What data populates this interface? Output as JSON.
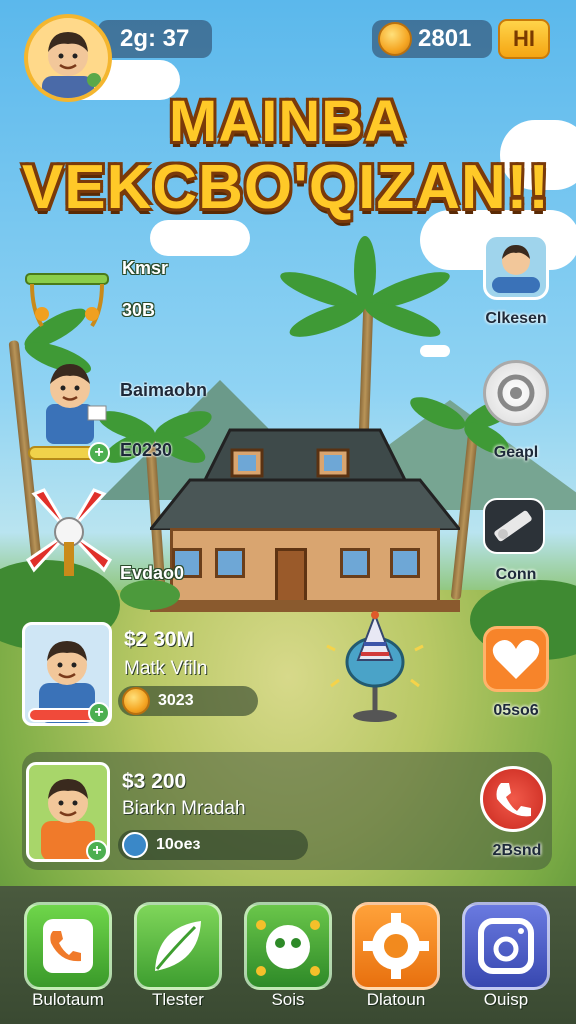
{
  "header": {
    "level_text": "2g: 37",
    "coins_text": "2801",
    "hi_label": "HI"
  },
  "title": {
    "line1": "MAINBA",
    "line2": "VEKCBO'QIZAN!!"
  },
  "left_items": [
    {
      "label": "Kmsr",
      "value": "30B"
    },
    {
      "label": "Baimaobn",
      "value": "E0230"
    },
    {
      "label": "Evdao0"
    }
  ],
  "right_buttons": [
    {
      "label": "Clkesen",
      "icon": "player-icon"
    },
    {
      "label": "Geapl",
      "icon": "settings-icon"
    },
    {
      "label": "Conn",
      "icon": "pencil-icon"
    },
    {
      "label": "05so6",
      "icon": "heart-icon",
      "color": "#f7842a"
    },
    {
      "label": "2Bsnd",
      "icon": "phone-icon",
      "color": "#e03a2e"
    }
  ],
  "cards": [
    {
      "score": "$2 30M",
      "name": "Matk Vfiln",
      "stat": "3023"
    },
    {
      "score": "$3 200",
      "name": "Biarkn Mradah",
      "stat": "10oeз"
    }
  ],
  "dock": [
    {
      "label": "Bulotaum",
      "icon": "phone-icon",
      "color": "#4cb848"
    },
    {
      "label": "Tlester",
      "icon": "leaf-icon",
      "color": "#55b84a"
    },
    {
      "label": "Sois",
      "icon": "alien-icon",
      "color": "#49a83c"
    },
    {
      "label": "Dlatoun",
      "icon": "gear-icon",
      "color": "#f28a1e"
    },
    {
      "label": "Ouisp",
      "icon": "camera-icon",
      "color": "#4a5ac8"
    }
  ]
}
